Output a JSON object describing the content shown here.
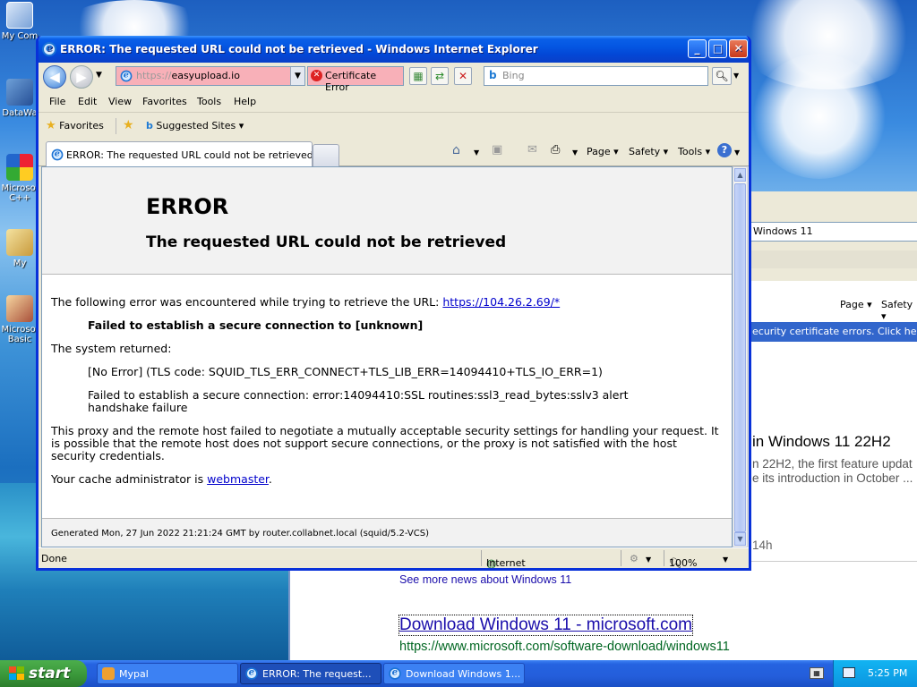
{
  "desktop": {
    "icons": [
      {
        "label": "My Com",
        "icon": "my-computer-icon"
      },
      {
        "label": "DataWa",
        "icon": "datawarehouse-icon"
      },
      {
        "label": "Microsol C++",
        "icon": "visual-cpp-icon"
      },
      {
        "label": "My",
        "icon": "my-documents-icon"
      },
      {
        "label": "Microsol Basic",
        "icon": "visual-basic-icon"
      }
    ]
  },
  "background_window": {
    "address": "Windows 11",
    "page_label": "Page ▾",
    "safety_label": "Safety ▾",
    "security_bar": "ecurity certificate errors. Click here fo",
    "headline": "in Windows 11 22H2",
    "snippet1": "n 22H2, the first feature updat",
    "snippet2": "e its introduction in October ...",
    "time_ago": "14h",
    "more_news": "See more news about Windows 11",
    "result_title": "Download Windows 11 - microsoft.com",
    "result_url": "https://www.microsoft.com/software-download/windows11"
  },
  "ie": {
    "title": "ERROR: The requested URL could not be retrieved - Windows Internet Explorer",
    "url_prefix": "https://",
    "url_host": "easyupload.io",
    "cert_error": "Certificate Error",
    "search_placeholder": "Bing",
    "menu": [
      "File",
      "Edit",
      "View",
      "Favorites",
      "Tools",
      "Help"
    ],
    "favorites_label": "Favorites",
    "suggested_sites": "Suggested Sites ▾",
    "tab_title": "ERROR: The requested URL could not be retrieved",
    "commands": {
      "page": "Page ▾",
      "safety": "Safety ▾",
      "tools": "Tools ▾"
    },
    "status": {
      "text": "Done",
      "zone": "Internet",
      "zoom": "100%"
    }
  },
  "error_page": {
    "heading": "ERROR",
    "subheading": "The requested URL could not be retrieved",
    "intro": "The following error was encountered while trying to retrieve the URL:",
    "url": "https://104.26.2.69/*",
    "failed": "Failed to establish a secure connection to [unknown]",
    "system_returned": "The system returned:",
    "no_error": "[No Error] (TLS code: SQUID_TLS_ERR_CONNECT+TLS_LIB_ERR=14094410+TLS_IO_ERR=1)",
    "ssl_line1": "Failed to establish a secure connection: error:14094410:SSL routines:ssl3_read_bytes:sslv3 alert",
    "ssl_line2": "handshake failure",
    "proxy_line1": "This proxy and the remote host failed to negotiate a mutually acceptable security settings for handling your request. It",
    "proxy_line2": "is possible that the remote host does not support secure connections, or the proxy is not satisfied with the host",
    "proxy_line3": "security credentials.",
    "admin_prefix": "Your cache administrator is",
    "admin_link": "webmaster",
    "admin_suffix": ".",
    "footer": "Generated Mon, 27 Jun 2022 21:21:24 GMT by router.collabnet.local (squid/5.2-VCS)"
  },
  "taskbar": {
    "start": "start",
    "tasks": [
      {
        "label": "Mypal",
        "active": false
      },
      {
        "label": "ERROR: The request...",
        "active": true
      },
      {
        "label": "Download Windows 1...",
        "active": false
      }
    ],
    "clock": "5:25 PM"
  }
}
